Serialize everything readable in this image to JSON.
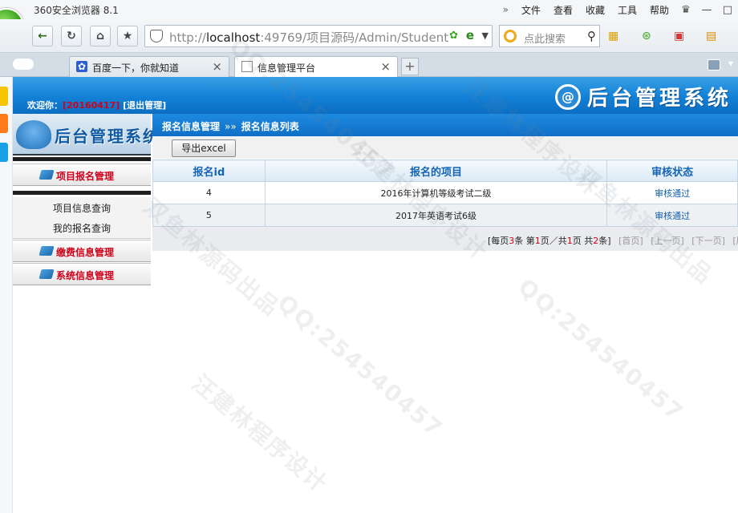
{
  "browser": {
    "app_name": "360安全浏览器 8.1",
    "logo_letter": "e",
    "menu": [
      "文件",
      "查看",
      "收藏",
      "工具",
      "帮助"
    ],
    "menu_more": "»",
    "address": {
      "scheme": "http://",
      "host": "localhost",
      "rest": ":49769/项目源码/Admin/Student"
    },
    "search_placeholder": "点此搜索",
    "tabs": [
      {
        "label": "百度一下，你就知道",
        "icon": "baidu-paw-icon",
        "active": false
      },
      {
        "label": "信息管理平台",
        "icon": "page-icon",
        "active": true
      }
    ],
    "new_tab_label": "+"
  },
  "header": {
    "welcome_prefix": "欢迎你：",
    "user_id": "[20160417]",
    "logout_label": "[退出管理]",
    "system_title": "后台管理系统",
    "logo_letter": "@"
  },
  "sidebar": {
    "title": "后台管理系统",
    "groups": [
      {
        "label": "项目报名管理",
        "expanded": true
      },
      {
        "label": "缴费信息管理",
        "expanded": false
      },
      {
        "label": "系统信息管理",
        "expanded": false
      }
    ],
    "sub_items": [
      "项目信息查询",
      "我的报名查询"
    ]
  },
  "main": {
    "breadcrumb": [
      "报名信息管理",
      "报名信息列表"
    ],
    "breadcrumb_sep": "»»",
    "export_label": "导出excel",
    "table": {
      "headers": [
        "报名id",
        "报名的项目",
        "审核状态"
      ],
      "rows": [
        [
          "4",
          "2016年计算机等级考试二级",
          "审核通过"
        ],
        [
          "5",
          "2017年英语考试6级",
          "审核通过"
        ]
      ]
    },
    "pager": {
      "per_page_prefix": "[每页",
      "per_page": "3",
      "per_page_suffix": "条 第",
      "current": "1",
      "mid": "页／共",
      "total_pages": "1",
      "total_prefix": "页 共",
      "total": "2",
      "total_suffix": "条]",
      "first": "[首页]",
      "prev": "[上一页]",
      "next": "[下一页]",
      "last": "[尾"
    }
  },
  "watermarks": [
    "汪建林程序设计",
    "QQ:254540457",
    "双鱼林源码出品"
  ],
  "colors": {
    "accent_blue": "#1280d6",
    "menu_red": "#d0021b",
    "header_text": "#1565b5"
  }
}
